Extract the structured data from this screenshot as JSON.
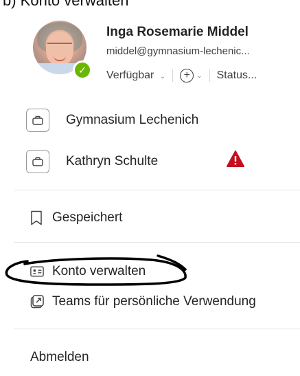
{
  "heading_cut": "b) Konto verwalten",
  "profile": {
    "name": "Inga Rosemarie Middel",
    "email": "middel@gymnasium-lechenic...",
    "availability": "Verfügbar",
    "status_message": "Status...",
    "presence_color": "#6bb700"
  },
  "organizations": [
    {
      "label": "Gymnasium Lechenich",
      "icon": "briefcase-icon"
    },
    {
      "label": "Kathryn Schulte",
      "icon": "briefcase-icon",
      "warning": true,
      "warning_color": "#c50f1f"
    }
  ],
  "menu": {
    "saved_label": "Gespeichert",
    "manage_account_label": "Konto verwalten",
    "teams_personal_label": "Teams für persönliche Verwendung",
    "sign_out_label": "Abmelden"
  }
}
